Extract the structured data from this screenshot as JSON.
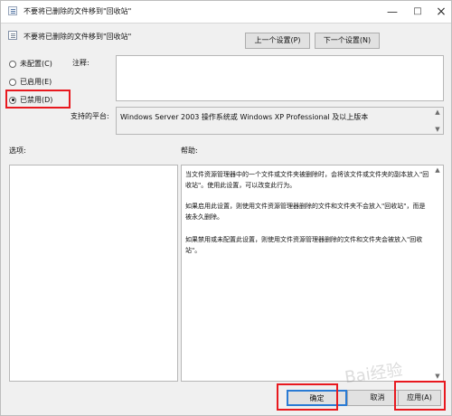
{
  "window": {
    "title": "不要将已删除的文件移到\"回收站\""
  },
  "header": {
    "policy_name": "不要将已删除的文件移到\"回收站\"",
    "prev_label": "上一个设置(P)",
    "next_label": "下一个设置(N)"
  },
  "settings": {
    "options": [
      {
        "label": "未配置(C)",
        "selected": false
      },
      {
        "label": "已启用(E)",
        "selected": false
      },
      {
        "label": "已禁用(D)",
        "selected": true
      }
    ],
    "comment_label": "注释:",
    "comment_value": "",
    "platform_label": "支持的平台:",
    "platform_value": "Windows Server 2003 操作系统或 Windows XP Professional 及以上版本",
    "options_label": "选项:",
    "help_label": "帮助:"
  },
  "help": {
    "p1": "当文件资源管理器中的一个文件或文件夹被删除时，会将该文件或文件夹的副本放入\"回收站\"。使用此设置，可以改变此行为。",
    "p2": "如果启用此设置，则使用文件资源管理器删除的文件和文件夹不会放入\"回收站\"，而是被永久删除。",
    "p3": "如果禁用或未配置此设置，则使用文件资源管理器删除的文件和文件夹会被放入\"回收站\"。"
  },
  "footer": {
    "ok_label": "确定",
    "cancel_label": "取消",
    "apply_label": "应用(A)"
  },
  "colors": {
    "highlight": "#e8191f",
    "focused_button": "#2a7bd4"
  },
  "icons": {
    "app": "policy-icon",
    "minimize": "minimize-icon",
    "maximize": "maximize-icon",
    "close": "close-icon"
  },
  "watermark": "Bai经验"
}
